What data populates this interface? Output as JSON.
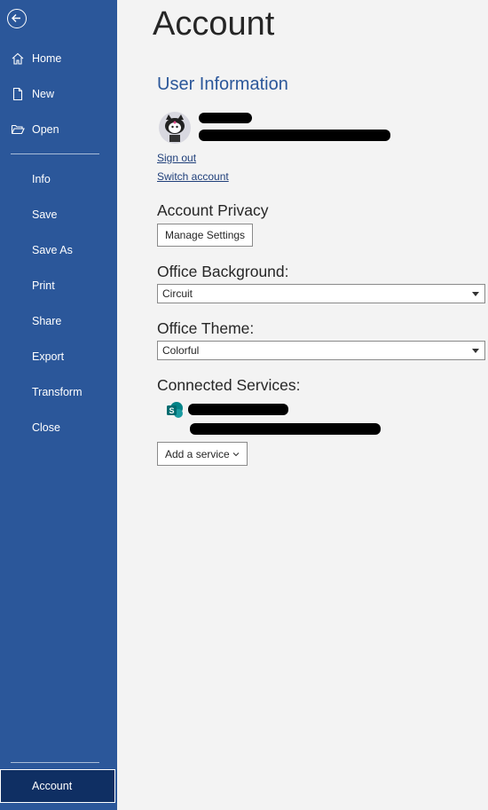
{
  "sidebar": {
    "items": [
      {
        "label": "Home"
      },
      {
        "label": "New"
      },
      {
        "label": "Open"
      },
      {
        "label": "Info"
      },
      {
        "label": "Save"
      },
      {
        "label": "Save As"
      },
      {
        "label": "Print"
      },
      {
        "label": "Share"
      },
      {
        "label": "Export"
      },
      {
        "label": "Transform"
      },
      {
        "label": "Close"
      }
    ],
    "account_label": "Account",
    "background_color": "#2b579a",
    "selected_color": "#0f2f63"
  },
  "main": {
    "title": "Account",
    "user_info": {
      "heading": "User Information",
      "sign_out": "Sign out",
      "switch_account": "Switch account"
    },
    "privacy": {
      "heading": "Account Privacy",
      "button": "Manage Settings"
    },
    "background": {
      "heading": "Office Background:",
      "value": "Circuit"
    },
    "theme": {
      "heading": "Office Theme:",
      "value": "Colorful"
    },
    "services": {
      "heading": "Connected Services:",
      "service_icon": "sharepoint-icon",
      "add_button": "Add a service"
    }
  }
}
